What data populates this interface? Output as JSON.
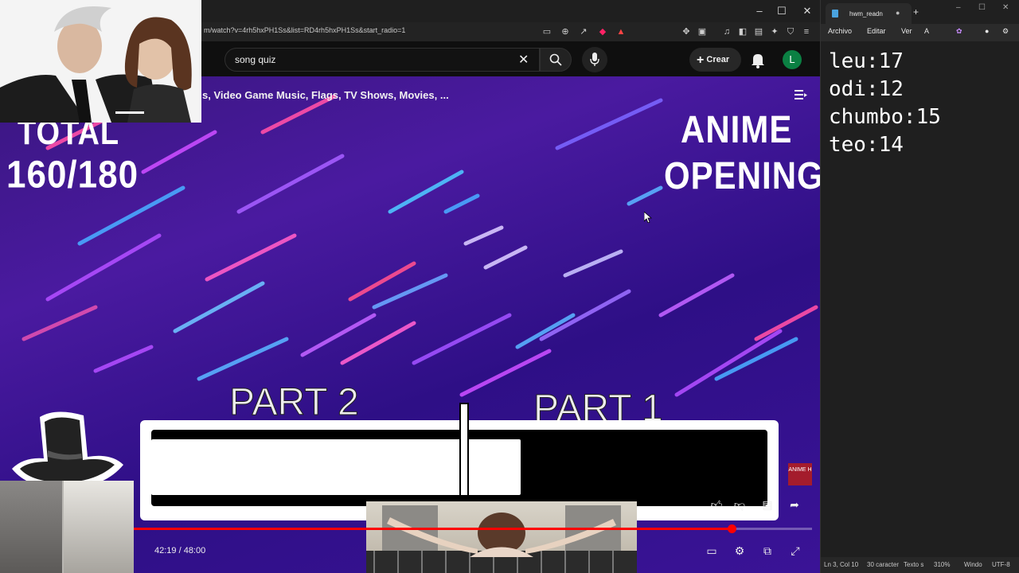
{
  "browser": {
    "url": "m/watch?v=4rh5hxPH1Ss&list=RD4rh5hxPH1Ss&start_radio=1",
    "window_controls": {
      "minimize": "–",
      "maximize": "☐",
      "close": "✕"
    }
  },
  "youtube": {
    "search_value": "song quiz",
    "create_label": "Crear",
    "avatar_letter": "L",
    "playlist_title": "s, Video Game Music, Flags, TV Shows, Movies, ..."
  },
  "video": {
    "score_label": "TOTAL",
    "score_value": "160/180",
    "genre_line1": "ANIME",
    "genre_line2": "OPENING",
    "part_left": "PART 2",
    "part_right": "PART 1",
    "progress_fraction": 0.6,
    "time": "42:19 / 48:00",
    "played_fraction": 0.8817,
    "badge_text": "ANIME H"
  },
  "notepad": {
    "tab_title": "hwm_readn",
    "menu": [
      "Archivo",
      "Editar",
      "Ver"
    ],
    "lines": [
      "leu:17",
      "odi:12",
      "chumbo:15",
      "teo:14"
    ],
    "status": {
      "position": "Ln 3, Col 10",
      "chars": "30 caracter",
      "format": "Texto s",
      "zoom": "310%",
      "eol": "Windo",
      "encoding": "UTF-8"
    }
  },
  "colors": {
    "video_bg": "#3a1690",
    "accent_red": "#ff0000",
    "avatar_green": "#0b8043"
  }
}
